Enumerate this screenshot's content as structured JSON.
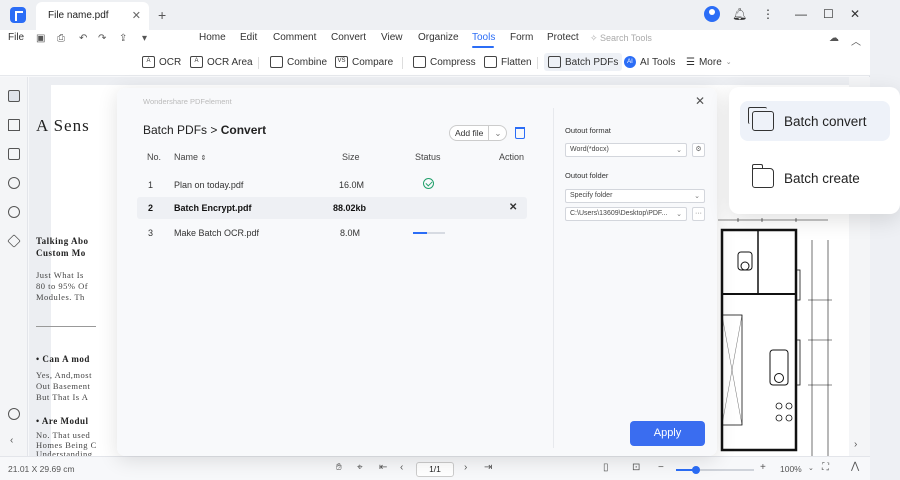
{
  "window": {
    "tab_title": "File name.pdf",
    "close_tab": "✕",
    "new_tab": "+",
    "minimize": "—",
    "maximize": "☐",
    "close": "✕"
  },
  "menu": {
    "file": "File",
    "items": [
      "Home",
      "Edit",
      "Comment",
      "Convert",
      "View",
      "Organize",
      "Tools",
      "Form",
      "Protect"
    ],
    "active": "Tools",
    "search_placeholder": "Search Tools"
  },
  "toolbar": {
    "tools": [
      {
        "label": "OCR",
        "icon": "ocr-icon"
      },
      {
        "label": "OCR Area",
        "icon": "ocr-area-icon"
      },
      {
        "label": "Combine",
        "icon": "combine-icon"
      },
      {
        "label": "Compare",
        "icon": "compare-icon"
      },
      {
        "label": "Compress",
        "icon": "compress-icon"
      },
      {
        "label": "Flatten",
        "icon": "flatten-icon"
      },
      {
        "label": "Batch PDFs",
        "icon": "batch-icon"
      },
      {
        "label": "AI Tools",
        "icon": "ai-icon"
      },
      {
        "label": "More",
        "icon": "more-icon"
      }
    ]
  },
  "document": {
    "title": "A Sens",
    "subtitle1a": "Talking Abo",
    "subtitle1b": "Custom Mo",
    "text1": "Just What Is",
    "text2": "80 to 95% Of",
    "text3": "Modules. Th",
    "bullet1": "• Can A mod",
    "text4": "Yes, And,most",
    "text5": "Out Basement",
    "text6": "But That Is A",
    "bullet2": "• Are Modul",
    "text7": "No. That used",
    "text8": "Homes Being C",
    "text9": "Understanding"
  },
  "modal": {
    "brand": "Wondershare PDFelement",
    "close": "✕",
    "breadcrumb_parent": "Batch PDFs",
    "breadcrumb_sep": ">",
    "breadcrumb_current": "Convert",
    "add_file": "Add file",
    "columns": {
      "no": "No.",
      "name": "Name",
      "size": "Size",
      "status": "Status",
      "action": "Action"
    },
    "rows": [
      {
        "no": "1",
        "name": "Plan on today.pdf",
        "size": "16.0M",
        "status": "done"
      },
      {
        "no": "2",
        "name": "Batch Encrypt.pdf",
        "size": "88.02kb",
        "status": "selected",
        "action": "✕"
      },
      {
        "no": "3",
        "name": "Make Batch OCR.pdf",
        "size": "8.0M",
        "status": "progress",
        "progress": 0.45
      }
    ],
    "output_format_label": "Outout format",
    "output_format_value": "Word(*docx)",
    "output_folder_label": "Outout folder",
    "folder_option": "Specify folder",
    "folder_path": "C:\\Users\\13609\\Desktop\\PDF...",
    "more": "···",
    "apply": "Apply"
  },
  "popover": {
    "items": [
      {
        "label": "Batch convert",
        "icon": "batch-convert-icon",
        "active": true
      },
      {
        "label": "Batch create",
        "icon": "batch-create-icon",
        "active": false
      }
    ]
  },
  "status": {
    "dimensions": "21.01 X 29.69 cm",
    "page": "1/1",
    "zoom": "100%",
    "zoom_level": 0.25
  },
  "colors": {
    "accent": "#2b6df6",
    "success": "#22a06b",
    "apply": "#3a6df0"
  }
}
